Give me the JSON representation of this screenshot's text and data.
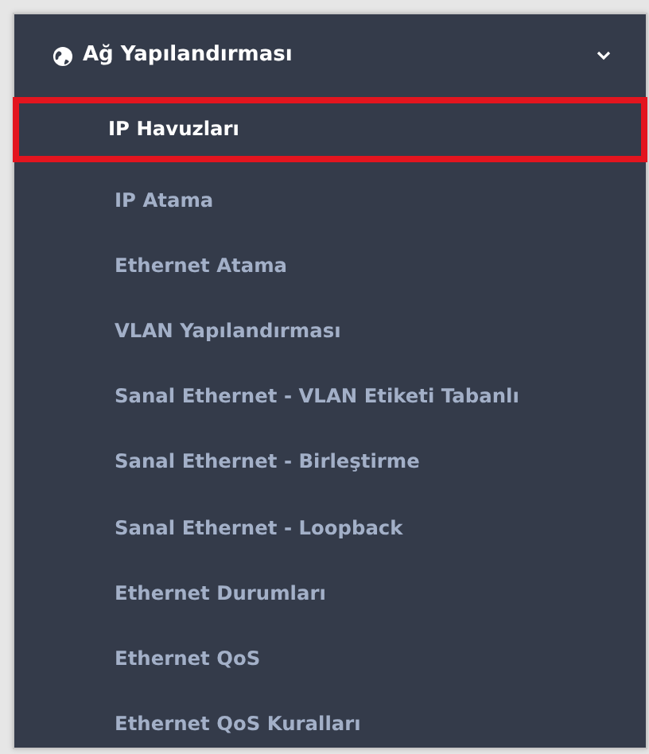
{
  "menu": {
    "title": "Ağ Yapılandırması",
    "expanded": true,
    "items": [
      {
        "label": "IP Havuzları",
        "selected": true
      },
      {
        "label": "IP Atama",
        "selected": false
      },
      {
        "label": "Ethernet Atama",
        "selected": false
      },
      {
        "label": "VLAN Yapılandırması",
        "selected": false
      },
      {
        "label": "Sanal Ethernet - VLAN Etiketi Tabanlı",
        "selected": false
      },
      {
        "label": "Sanal Ethernet - Birleştirme",
        "selected": false
      },
      {
        "label": "Sanal Ethernet - Loopback",
        "selected": false
      },
      {
        "label": "Ethernet Durumları",
        "selected": false
      },
      {
        "label": "Ethernet QoS",
        "selected": false
      },
      {
        "label": "Ethernet QoS Kuralları",
        "selected": false
      }
    ]
  }
}
